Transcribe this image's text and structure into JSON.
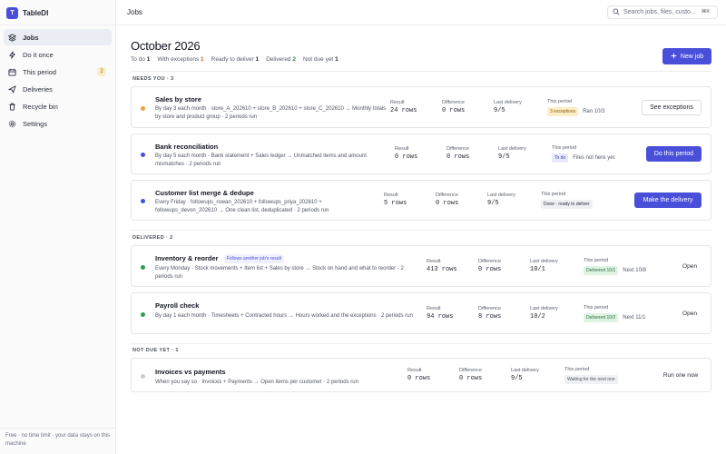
{
  "app": {
    "logo_letter": "T",
    "name": "TableDI"
  },
  "sidebar": {
    "items": [
      {
        "label": "Jobs",
        "icon": "stack-icon"
      },
      {
        "label": "Do it once",
        "icon": "bolt-icon"
      },
      {
        "label": "This period",
        "icon": "calendar-icon",
        "badge": "2"
      },
      {
        "label": "Deliveries",
        "icon": "send-icon"
      },
      {
        "label": "Recycle bin",
        "icon": "trash-icon"
      },
      {
        "label": "Settings",
        "icon": "gear-icon"
      }
    ],
    "footer": "Free · no time limit · your data stays on this machine"
  },
  "topbar": {
    "title": "Jobs",
    "search_placeholder": "Search jobs, files, custo...",
    "search_shortcut": "⌘K"
  },
  "header": {
    "title": "October 2026",
    "new_job_label": "New job",
    "counts": [
      {
        "label": "To do",
        "value": "1"
      },
      {
        "label": "With exceptions",
        "value": "1"
      },
      {
        "label": "Ready to deliver",
        "value": "1"
      },
      {
        "label": "Delivered",
        "value": "2"
      },
      {
        "label": "Not due yet",
        "value": "1"
      }
    ]
  },
  "sections": {
    "needs_you": "NEEDS YOU · 3",
    "delivered": "DELIVERED · 2",
    "not_due": "NOT DUE YET · 1"
  },
  "metric_labels": {
    "result": "Result",
    "difference": "Difference",
    "last_delivery": "Last delivery",
    "this_period": "This period"
  },
  "jobs": [
    {
      "name": "Sales by store",
      "desc": "By day 3 each month · store_A_202610 + store_B_202610 + store_C_202610 → Monthly totals by store and product group · 2 periods run",
      "result": "24 rows",
      "difference": "0 rows",
      "last_delivery": "9/5",
      "status": "3 exceptions",
      "note": "Ran 10/3",
      "action": "See exceptions",
      "dot_color": "#e8a33a"
    },
    {
      "name": "Bank reconciliation",
      "desc": "By day 5 each month · Bank statement + Sales ledger → Unmatched items and amount mismatches · 2 periods run",
      "result": "0 rows",
      "difference": "0 rows",
      "last_delivery": "9/5",
      "status": "To do",
      "note": "Files not here yet",
      "action": "Do this period",
      "dot_color": "#4a4fd9"
    },
    {
      "name": "Customer list merge & dedupe",
      "desc": "Every Friday · followups_rowan_202610 + followups_priya_202610 + followups_devon_202610 → One clean list, deduplicated · 2 periods run",
      "result": "5 rows",
      "difference": "0 rows",
      "last_delivery": "9/5",
      "status": "Done · ready to deliver",
      "note": "",
      "action": "Make the delivery",
      "dot_color": "#4a4fd9"
    },
    {
      "name": "Inventory & reorder",
      "tag": "Follows another job's result",
      "desc": "Every Monday · Stock movements + Item list + Sales by store → Stock on hand and what to reorder · 2 periods run",
      "result": "413 rows",
      "difference": "0 rows",
      "last_delivery": "10/1",
      "status": "Delivered 10/1",
      "note": "Next 10/8",
      "action": "Open",
      "dot_color": "#2e9e55"
    },
    {
      "name": "Payroll check",
      "desc": "By day 1 each month · Timesheets + Contracted hours → Hours worked and the exceptions · 2 periods run",
      "result": "94 rows",
      "difference": "8 rows",
      "last_delivery": "10/2",
      "status": "Delivered 10/2",
      "note": "Next 11/1",
      "action": "Open",
      "dot_color": "#2e9e55"
    },
    {
      "name": "Invoices vs payments",
      "desc": "When you say so · Invoices + Payments → Open items per customer · 2 periods run",
      "result": "0 rows",
      "difference": "0 rows",
      "last_delivery": "9/5",
      "status": "Waiting for the next one",
      "note": "",
      "action": "Run one now",
      "dot_color": "#c9ccd6"
    }
  ]
}
